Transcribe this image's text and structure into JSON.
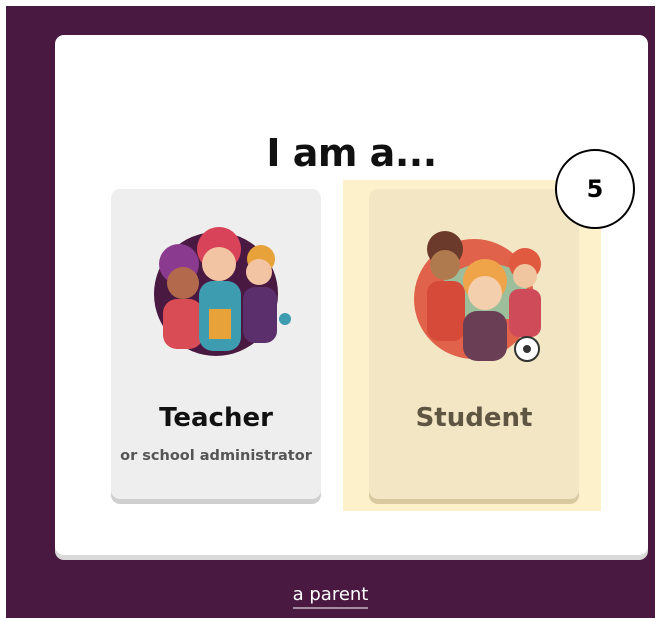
{
  "heading": "I am a...",
  "roles": [
    {
      "title": "Teacher",
      "subtitle": "or school administrator",
      "illustration": "teacher-group-illustration"
    },
    {
      "title": "Student",
      "subtitle": "",
      "illustration": "student-group-illustration"
    }
  ],
  "step_badge": "5",
  "parent_link": "a parent",
  "colors": {
    "background": "#4a1942",
    "card": "#ffffff",
    "teacher_card": "#eeeeee",
    "student_card": "#f2e6c4",
    "highlight": "#fdf1cc"
  }
}
